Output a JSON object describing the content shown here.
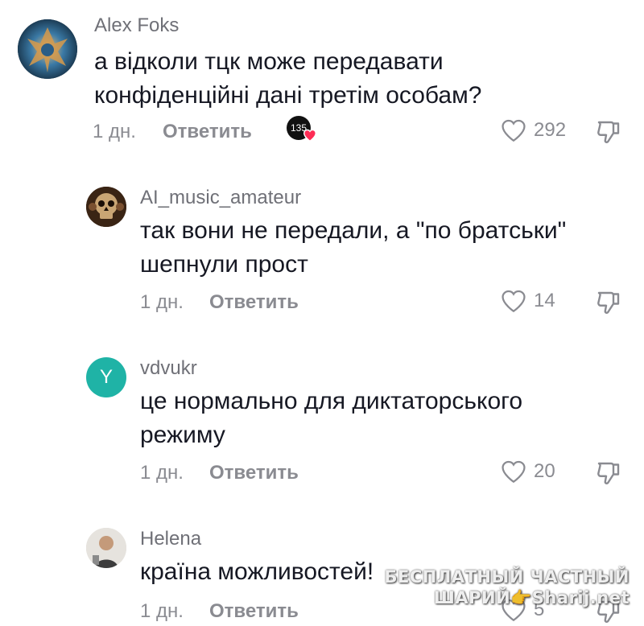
{
  "comments": [
    {
      "username": "Alex Foks",
      "text_line1": "а відколи тцк може передавати",
      "text_line2": "конфіденційні дані третім особам?",
      "time": "1 дн.",
      "reply": "Ответить",
      "likes": "292",
      "badge_number": "135",
      "avatar_icon": "dragon-avatar"
    },
    {
      "username": "AI_music_amateur",
      "text_line1": "так вони не передали, а \"по братськи\"",
      "text_line2": "шепнули прост",
      "time": "1 дн.",
      "reply": "Ответить",
      "likes": "14",
      "avatar_icon": "skull-avatar"
    },
    {
      "username": "vdvukr",
      "avatar_letter": "Y",
      "text_line1": "це нормально для диктаторського",
      "text_line2": "режиму",
      "time": "1 дн.",
      "reply": "Ответить",
      "likes": "20",
      "avatar_color": "#1fb3a6"
    },
    {
      "username": "Helena",
      "text_line1": "країна можливостей!",
      "time": "1 дн.",
      "reply": "Ответить",
      "likes": "5",
      "avatar_icon": "person-photo-avatar"
    }
  ],
  "watermark": {
    "line1": "БЕСПЛАТНЫЙ ЧАСТНЫЙ",
    "line2": "ШАРИЙ👉Sharij.net"
  },
  "colors": {
    "text": "#161823",
    "muted": "#8a8b91",
    "username": "#6f7077",
    "heart_badge": "#fe2c55"
  }
}
